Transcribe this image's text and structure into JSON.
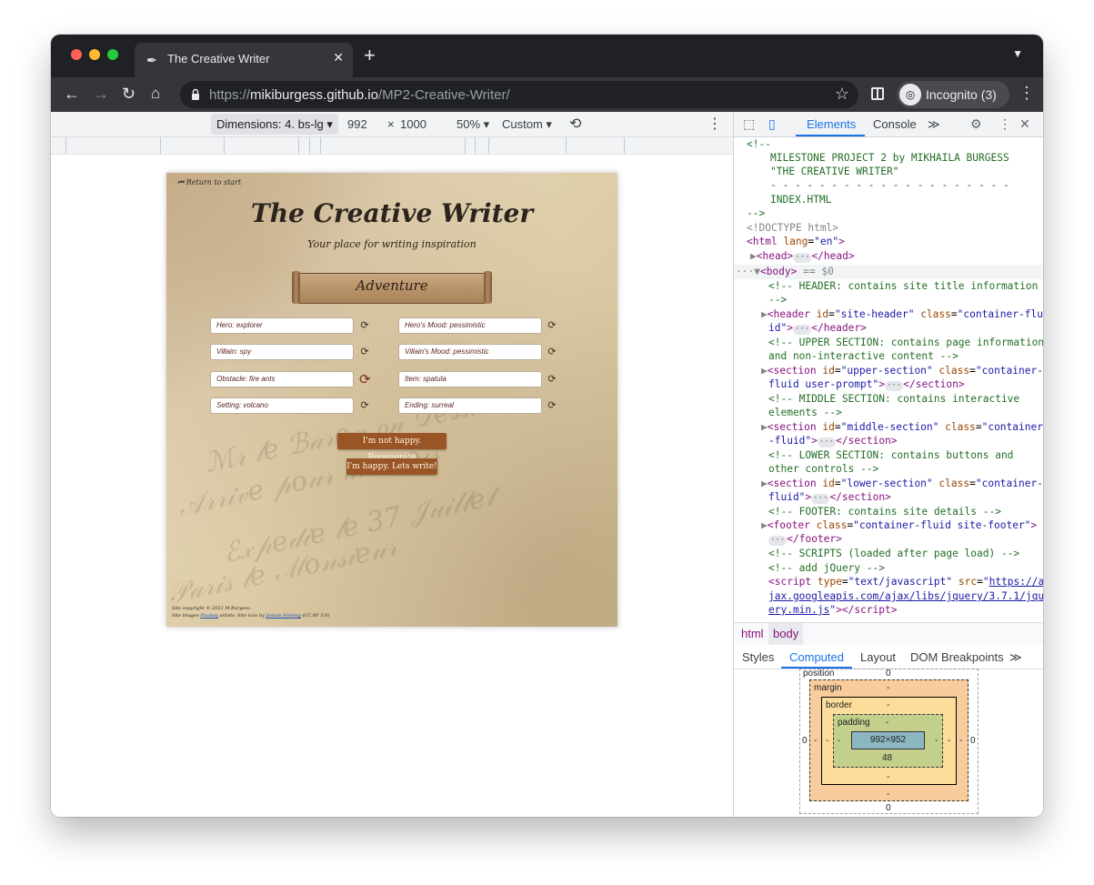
{
  "browser": {
    "tab_title": "The Creative Writer",
    "url_prefix": "https://",
    "url_host": "mikiburgess.github.io",
    "url_path": "/MP2-Creative-Writer/",
    "profile_label": "Incognito (3)"
  },
  "device_toolbar": {
    "dimensions": "Dimensions: 4. bs-lg",
    "width": "992",
    "height_sep": "×",
    "height": "1000",
    "zoom": "50%",
    "throttle": "Custom"
  },
  "page": {
    "return_link": "Return to start",
    "title": "The Creative Writer",
    "subtitle": "Your place for writing inspiration",
    "genre": "Adventure",
    "fields": [
      {
        "value": "Hero: explorer"
      },
      {
        "value": "Hero's Mood: pessimistic"
      },
      {
        "value": "Villain: spy"
      },
      {
        "value": "Villain's Mood: pessimistic"
      },
      {
        "value": "Obstacle: fire ants"
      },
      {
        "value": "Item: spatula"
      },
      {
        "value": "Setting: volcano"
      },
      {
        "value": "Ending: surreal"
      }
    ],
    "regenerate_label": "I'm not happy. Regenerate",
    "write_label": "I'm happy. Lets write!",
    "footer_copyright": "Site copyright © 2023 M Burgess.",
    "footer_images_a": "Site images",
    "footer_images_link": "Pixabay",
    "footer_images_b": "artists; Site icon by",
    "footer_icon_link": "Jamcie Holemg",
    "footer_license": "(CC BY 3.0)"
  },
  "devtools": {
    "tabs": [
      "Elements",
      "Console"
    ],
    "active_tab": "Elements",
    "breadcrumbs": [
      "html",
      "body"
    ],
    "sub_tabs": [
      "Styles",
      "Computed",
      "Layout",
      "DOM Breakpoints"
    ],
    "active_sub_tab": "Computed",
    "box_model": {
      "position_label": "position",
      "position_value": "0",
      "margin_label": "margin",
      "border_label": "border",
      "padding_label": "padding",
      "content_size": "992×952",
      "padding_bottom": "48",
      "dash": "-",
      "zero": "0"
    }
  },
  "icons": {
    "refresh": "refresh-icon",
    "accent": "#1a73e8",
    "button_color": "#9a5526"
  }
}
